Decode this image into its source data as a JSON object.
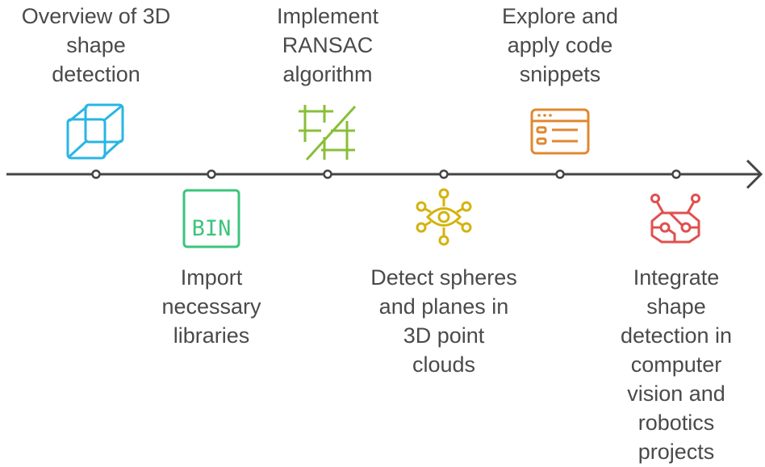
{
  "diagram": {
    "type": "timeline",
    "steps": [
      {
        "label": "Overview of 3D\nshape\ndetection",
        "icon": "cube-icon",
        "color": "#29b5e4",
        "position": "top"
      },
      {
        "label": "Import\nnecessary\nlibraries",
        "icon": "bin-icon",
        "icon_text": "BIN",
        "color": "#3cc47c",
        "position": "bottom"
      },
      {
        "label": "Implement\nRANSAC\nalgorithm",
        "icon": "grid-slash-icon",
        "color": "#88bf38",
        "position": "top"
      },
      {
        "label": "Detect spheres\nand planes in\n3D point\nclouds",
        "icon": "eye-network-icon",
        "color": "#d4b30c",
        "position": "bottom"
      },
      {
        "label": "Explore and\napply code\nsnippets",
        "icon": "browser-list-icon",
        "color": "#e08830",
        "position": "top"
      },
      {
        "label": "Integrate\nshape\ndetection in\ncomputer\nvision and\nrobotics\nprojects",
        "icon": "robot-icon",
        "color": "#e0504e",
        "position": "bottom"
      }
    ],
    "line_color": "#444444"
  }
}
